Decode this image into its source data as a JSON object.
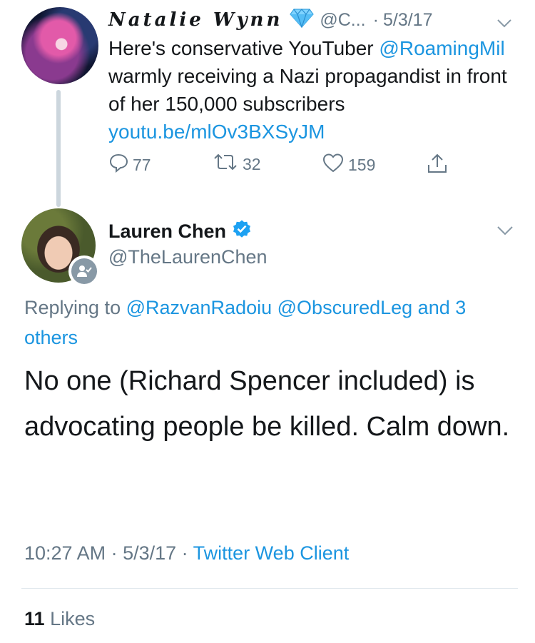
{
  "parent_tweet": {
    "name": "Natalie Wynn",
    "handle": "@C...",
    "date": "5/3/17",
    "text_intro": "Here's conservative YouTuber ",
    "mention": "@RoamingMil",
    "text_middle": " warmly receiving a Nazi propagandist in front of her 150,000 subscribers ",
    "link": "youtu.be/mlOv3BXSyJM",
    "replies": "77",
    "retweets": "32",
    "likes": "159",
    "icons": [
      "diamond-emoji-icon",
      "chevron-down-icon",
      "reply-icon",
      "retweet-icon",
      "heart-icon",
      "share-icon"
    ]
  },
  "main_tweet": {
    "name": "Lauren Chen",
    "handle": "@TheLaurenChen",
    "replying_prefix": "Replying to ",
    "replying_mention_1": "@RazvanRadoiu",
    "replying_mention_2": "@ObscuredLeg",
    "replying_and": "and",
    "replying_others": "3 others",
    "text": "No one (Richard Spencer included) is advocating people be killed. Calm down.",
    "time": "10:27 AM",
    "date": "5/3/17",
    "source": "Twitter Web Client",
    "like_count": "11",
    "like_label": "Likes",
    "icons": [
      "verified-badge-icon",
      "chevron-down-icon",
      "follow-badge-icon"
    ]
  },
  "colors": {
    "link": "#1b95e0",
    "muted": "#657786",
    "text": "#14171a",
    "verified": "#1da1f2"
  }
}
